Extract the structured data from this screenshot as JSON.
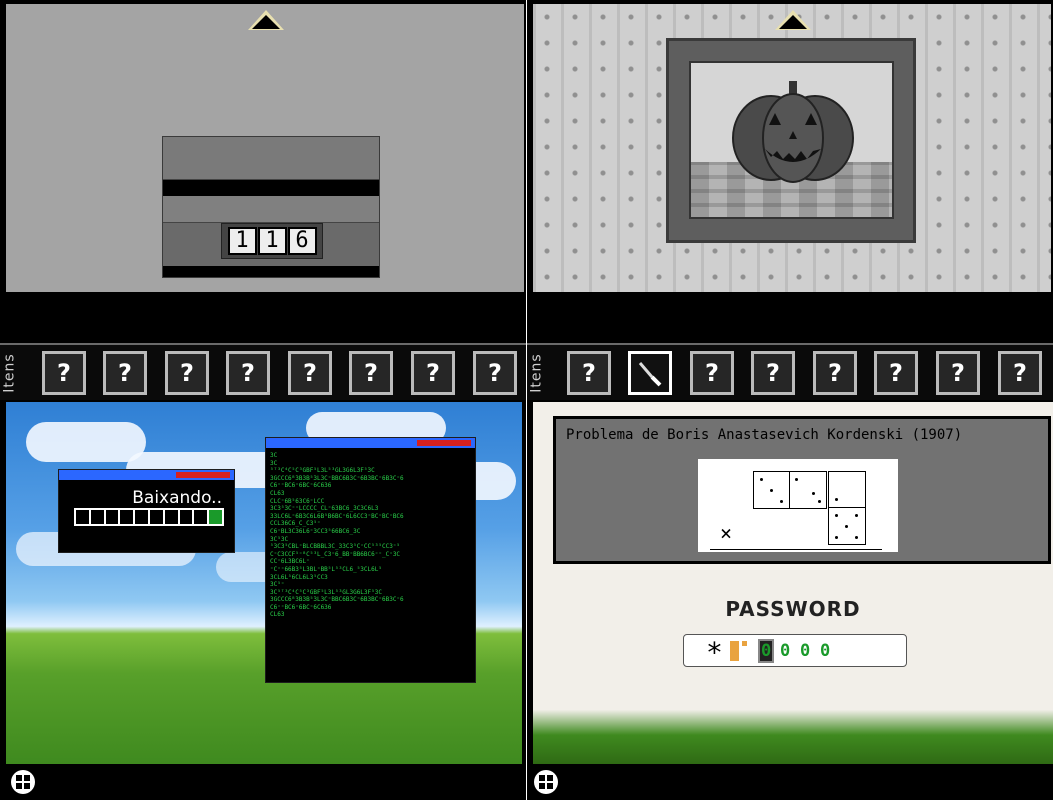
{
  "top_left": {
    "lock_digits": [
      "1",
      "1",
      "6"
    ],
    "inventory": {
      "label": "Itens",
      "slots": [
        "?",
        "?",
        "?",
        "?",
        "?",
        "?",
        "?",
        "?"
      ]
    }
  },
  "top_right": {
    "painting": "jack-o-lantern",
    "inventory": {
      "label": "Itens",
      "slots": [
        {
          "text": "?",
          "icon": "unknown-icon"
        },
        {
          "text": "",
          "icon": "knife-icon",
          "selected": true
        },
        {
          "text": "?",
          "icon": "unknown-icon"
        },
        {
          "text": "?",
          "icon": "unknown-dots-icon"
        },
        {
          "text": "?",
          "icon": "unknown-block-icon"
        },
        {
          "text": "?",
          "icon": "unknown-icon"
        },
        {
          "text": "?",
          "icon": "unknown-icon"
        },
        {
          "text": "?",
          "icon": "unknown-icon"
        }
      ]
    }
  },
  "bottom_left": {
    "download_window": {
      "status_text": "Baixando..",
      "progress_segments_total": 10,
      "progress_segments_filled": 1
    },
    "terminal_text": "3C\n3C\n⁵ᵀ³C⁴C⁵C³GBF⁵L3L⁵³GL3G6L3F⁵3C\n3GCCC6ᴮ3B3B⁵3L3C⁼BBC6B3C⁼6B3BC⁼6B3C⁼6\nC6⁼⁼BC6⁼6BC⁼6C636\nCL63\nCLC⁼6B⁵63C6⁼LCC\n3C3⁵3C⁼⁼LCCCC_CL⁼63BC6_3C3C6L3\n33LC6L⁼6B3C6L6B⁵B6BC⁼6L6CC3⁼BC⁼BC⁼BC6\nCCL36C6_C_C3⁵⁼\nC6⁼BL3C36L6⁼3CC3⁵66BC6_3C\n3C⁵3C\n⁵3C3⁵CBL⁼BLCBBBL3C_33C3⁵C⁼CC⁵³⁵CC3⁼⁵\nC⁼C3CCF⁵⁼ᴮC⁵³L_C3⁼6_BB⁼BB6BC6⁼⁼_C⁼3C\nCC⁼6L3BC6L⁼\n⁼C⁼⁼66B3⁵L3BL⁼BB⁵L⁵³CL6_⁵3CL6L⁵\n3CL6L⁵6CL6L3⁵CC3\n3C⁵⁼\n3C⁵ᵀ³C⁴C⁵C³GBF⁵L3L⁵³GL3G6L3F⁵3C\n3GCCC6ᴮ3B3B⁵3L3C⁼BBC6B3C⁼6B3BC⁼6B3C⁼6\nC6⁼⁼BC6⁼6BC⁼6C636\nCL63"
  },
  "bottom_right": {
    "problem_title": "Problema de Boris Anastasevich Kordenski (1907)",
    "multiply_sign": "×",
    "password_label": "PASSWORD",
    "password_field": {
      "prefix": "*",
      "digits": [
        "0",
        "0",
        "0",
        "0"
      ],
      "active_index": 0
    }
  }
}
